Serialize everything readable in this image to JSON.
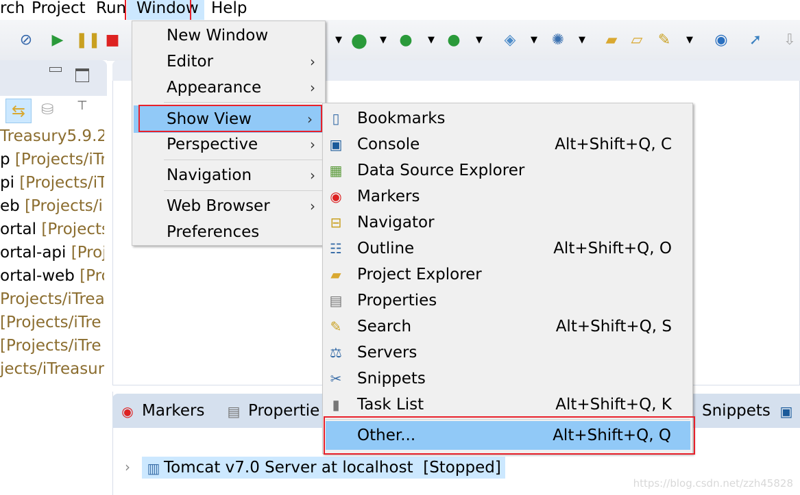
{
  "menubar": {
    "items": [
      "rch",
      "Project",
      "Run",
      "Window",
      "Help"
    ]
  },
  "left_tree": [
    {
      "name": "Treasury5.9.2",
      "path": ""
    },
    {
      "name": "p",
      "path": "[Projects/iTr"
    },
    {
      "name": "pi",
      "path": "[Projects/iT"
    },
    {
      "name": "eb",
      "path": "[Projects/i"
    },
    {
      "name": "ortal",
      "path": "[Projects/"
    },
    {
      "name": "ortal-api",
      "path": "[Proje"
    },
    {
      "name": "ortal-web",
      "path": "[Pro"
    },
    {
      "name": "",
      "path": "Projects/iTrea"
    },
    {
      "name": "",
      "path": "[Projects/iTre"
    },
    {
      "name": "",
      "path": "[Projects/iTre"
    },
    {
      "name": "",
      "path": "jects/iTreasur"
    }
  ],
  "window_menu": {
    "items": [
      {
        "label": "New Window",
        "submenu": false
      },
      {
        "label": "Editor",
        "submenu": true
      },
      {
        "label": "Appearance",
        "submenu": true
      },
      {
        "label": "Show View",
        "submenu": true,
        "selected": true
      },
      {
        "label": "Perspective",
        "submenu": true
      },
      {
        "label": "Navigation",
        "submenu": true
      },
      {
        "label": "Web Browser",
        "submenu": true
      },
      {
        "label": "Preferences",
        "submenu": false
      }
    ]
  },
  "show_view_menu": {
    "items": [
      {
        "label": "Bookmarks",
        "shortcut": "",
        "icon": "bookmarks-icon"
      },
      {
        "label": "Console",
        "shortcut": "Alt+Shift+Q, C",
        "icon": "console-icon"
      },
      {
        "label": "Data Source Explorer",
        "shortcut": "",
        "icon": "data-source-explorer-icon"
      },
      {
        "label": "Markers",
        "shortcut": "",
        "icon": "markers-icon"
      },
      {
        "label": "Navigator",
        "shortcut": "",
        "icon": "navigator-icon"
      },
      {
        "label": "Outline",
        "shortcut": "Alt+Shift+Q, O",
        "icon": "outline-icon"
      },
      {
        "label": "Project Explorer",
        "shortcut": "",
        "icon": "project-explorer-icon"
      },
      {
        "label": "Properties",
        "shortcut": "",
        "icon": "properties-icon"
      },
      {
        "label": "Search",
        "shortcut": "Alt+Shift+Q, S",
        "icon": "search-icon"
      },
      {
        "label": "Servers",
        "shortcut": "",
        "icon": "servers-icon"
      },
      {
        "label": "Snippets",
        "shortcut": "",
        "icon": "snippets-icon"
      },
      {
        "label": "Task List",
        "shortcut": "Alt+Shift+Q, K",
        "icon": "task-list-icon"
      }
    ],
    "other": {
      "label": "Other...",
      "shortcut": "Alt+Shift+Q, Q"
    }
  },
  "bottom_tabs": {
    "markers": "Markers",
    "properties": "Propertie",
    "snippets": "Snippets"
  },
  "server": {
    "label": "Tomcat v7.0 Server at localhost",
    "status": "[Stopped]"
  },
  "watermark": "https://blog.csdn.net/zzh45828",
  "colors": {
    "highlight": "#91c9f7",
    "annotation_red": "#e8202a",
    "selection": "#cce8ff"
  }
}
